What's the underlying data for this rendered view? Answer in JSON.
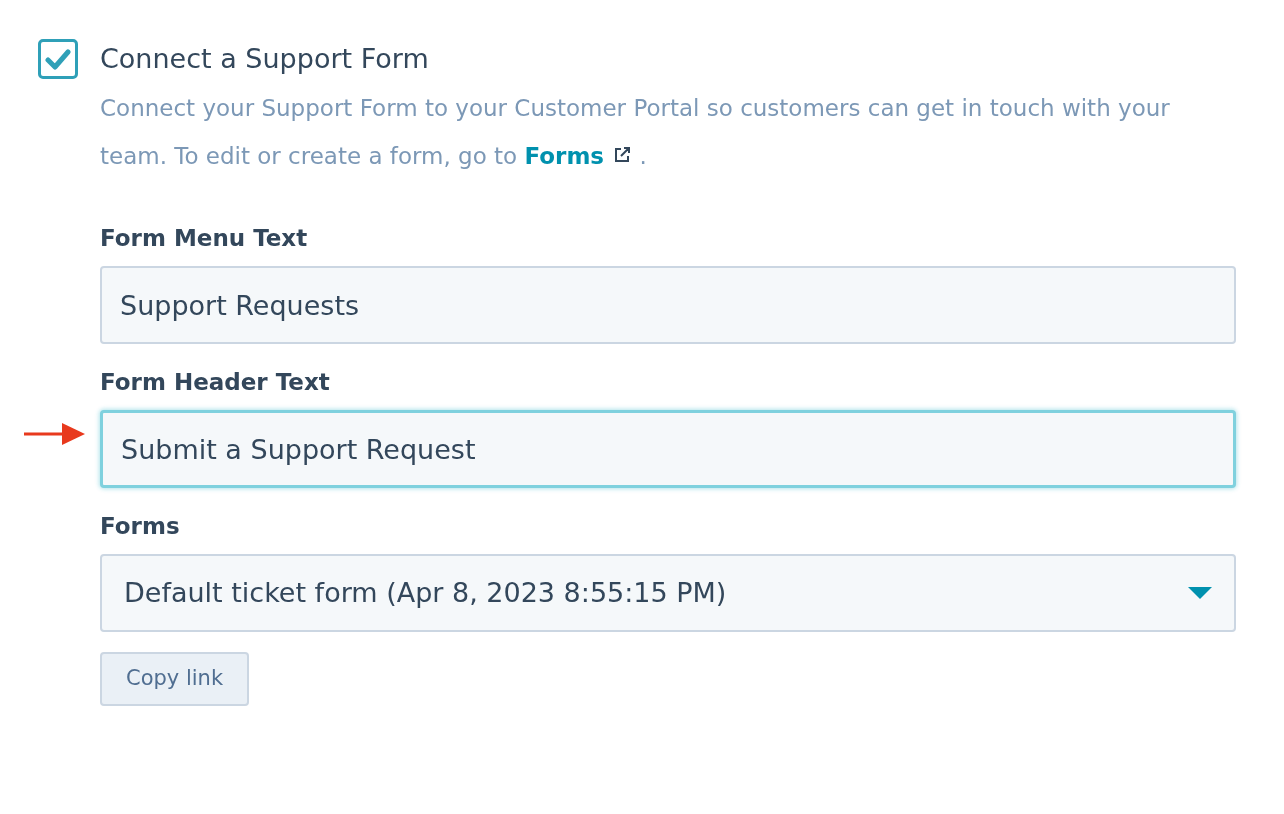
{
  "section": {
    "checked": true,
    "title": "Connect a Support Form",
    "description": {
      "text": "Connect your Support Form to your Customer Portal so customers can get in touch with your team. To edit or create a form, go to",
      "link": "Forms",
      "after": "."
    }
  },
  "fields": [
    {
      "kind": "text",
      "label": "Form Menu Text",
      "value": "Support Requests",
      "focused": false
    },
    {
      "kind": "text",
      "label": "Form Header Text",
      "value": "Submit a Support Request",
      "focused": true
    },
    {
      "kind": "select",
      "label": "Forms",
      "value": "Default ticket form (Apr 8, 2023 8:55:15 PM)",
      "focused": false
    }
  ],
  "buttons": [
    {
      "label": "Copy link"
    }
  ]
}
